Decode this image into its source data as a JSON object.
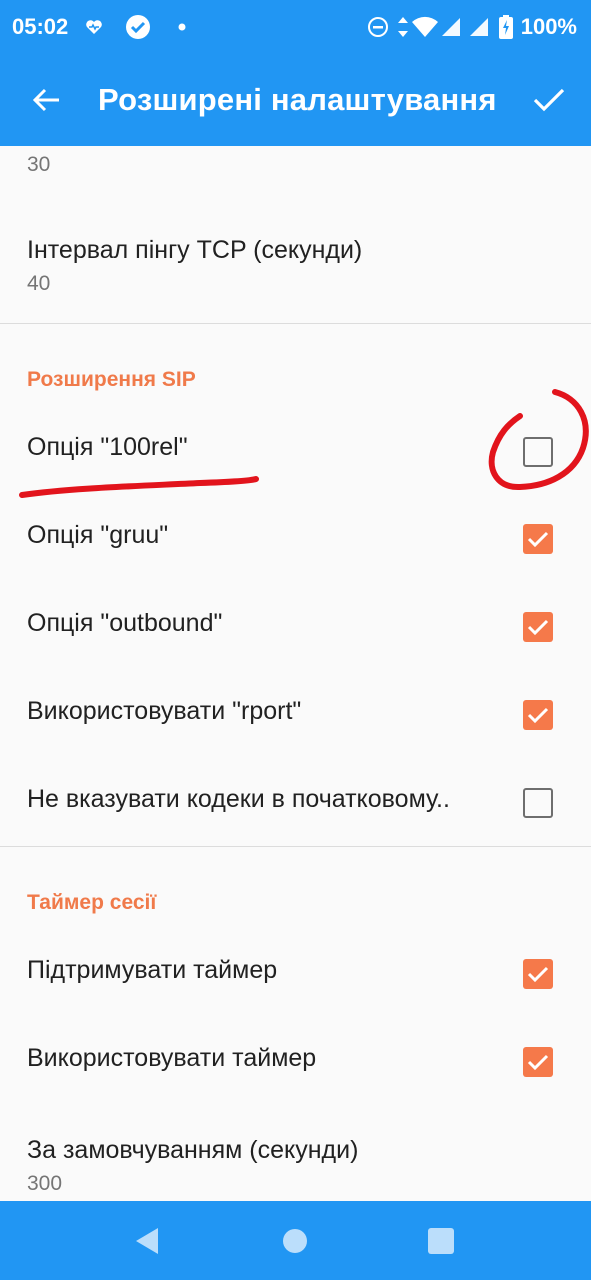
{
  "status_bar": {
    "time": "05:02",
    "battery_percent": "100%"
  },
  "app_bar": {
    "title": "Розширені налаштування"
  },
  "prefs": {
    "top_value": "30",
    "tcp_ping": {
      "title": "Інтервал пінгу TCP (секунди)",
      "value": "40"
    },
    "sip_category": "Розширення SIP",
    "sip_items": [
      {
        "label": "Опція \"100rel\"",
        "checked": false
      },
      {
        "label": "Опція \"gruu\"",
        "checked": true
      },
      {
        "label": "Опція \"outbound\"",
        "checked": true
      },
      {
        "label": "Використовувати \"rport\"",
        "checked": true
      },
      {
        "label": "Не вказувати кодеки в початковому..",
        "checked": false
      }
    ],
    "timer_category": "Таймер сесії",
    "timer_items": [
      {
        "label": "Підтримувати таймер",
        "checked": true
      },
      {
        "label": "Використовувати таймер",
        "checked": true
      }
    ],
    "default_timeout": {
      "title": "За замовчуванням (секунди)",
      "value": "300"
    }
  },
  "colors": {
    "primary": "#2196f3",
    "accent": "#f5794a",
    "annotation": "#e2141c"
  }
}
